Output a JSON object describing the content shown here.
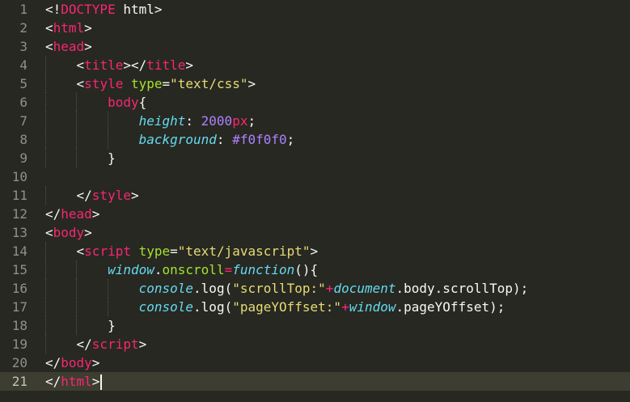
{
  "editor": {
    "active_line": 21,
    "lines": [
      {
        "no": "1",
        "indent": 0,
        "tokens": [
          {
            "c": "p",
            "t": "<!"
          },
          {
            "c": "t",
            "t": "DOCTYPE"
          },
          {
            "c": "p",
            "t": " html>"
          }
        ]
      },
      {
        "no": "2",
        "indent": 0,
        "tokens": [
          {
            "c": "p",
            "t": "<"
          },
          {
            "c": "t",
            "t": "html"
          },
          {
            "c": "p",
            "t": ">"
          }
        ]
      },
      {
        "no": "3",
        "indent": 0,
        "tokens": [
          {
            "c": "p",
            "t": "<"
          },
          {
            "c": "t",
            "t": "head"
          },
          {
            "c": "p",
            "t": ">"
          }
        ]
      },
      {
        "no": "4",
        "indent": 1,
        "tokens": [
          {
            "c": "p",
            "t": "<"
          },
          {
            "c": "t",
            "t": "title"
          },
          {
            "c": "p",
            "t": "></"
          },
          {
            "c": "t",
            "t": "title"
          },
          {
            "c": "p",
            "t": ">"
          }
        ]
      },
      {
        "no": "5",
        "indent": 1,
        "tokens": [
          {
            "c": "p",
            "t": "<"
          },
          {
            "c": "t",
            "t": "style"
          },
          {
            "c": "p",
            "t": " "
          },
          {
            "c": "a",
            "t": "type"
          },
          {
            "c": "p",
            "t": "="
          },
          {
            "c": "s",
            "t": "\"text/css\""
          },
          {
            "c": "p",
            "t": ">"
          }
        ]
      },
      {
        "no": "6",
        "indent": 2,
        "tokens": [
          {
            "c": "t",
            "t": "body"
          },
          {
            "c": "p",
            "t": "{"
          }
        ]
      },
      {
        "no": "7",
        "indent": 3,
        "tokens": [
          {
            "c": "c",
            "t": "height"
          },
          {
            "c": "p",
            "t": ": "
          },
          {
            "c": "n",
            "t": "2000"
          },
          {
            "c": "t",
            "t": "px"
          },
          {
            "c": "p",
            "t": ";"
          }
        ]
      },
      {
        "no": "8",
        "indent": 3,
        "tokens": [
          {
            "c": "c",
            "t": "background"
          },
          {
            "c": "p",
            "t": ": "
          },
          {
            "c": "n",
            "t": "#f0f0f0"
          },
          {
            "c": "p",
            "t": ";"
          }
        ]
      },
      {
        "no": "9",
        "indent": 2,
        "tokens": [
          {
            "c": "p",
            "t": "}"
          }
        ]
      },
      {
        "no": "10",
        "indent": 0,
        "tokens": []
      },
      {
        "no": "11",
        "indent": 1,
        "tokens": [
          {
            "c": "p",
            "t": "</"
          },
          {
            "c": "t",
            "t": "style"
          },
          {
            "c": "p",
            "t": ">"
          }
        ]
      },
      {
        "no": "12",
        "indent": 0,
        "tokens": [
          {
            "c": "p",
            "t": "</"
          },
          {
            "c": "t",
            "t": "head"
          },
          {
            "c": "p",
            "t": ">"
          }
        ]
      },
      {
        "no": "13",
        "indent": 0,
        "tokens": [
          {
            "c": "p",
            "t": "<"
          },
          {
            "c": "t",
            "t": "body"
          },
          {
            "c": "p",
            "t": ">"
          }
        ]
      },
      {
        "no": "14",
        "indent": 1,
        "tokens": [
          {
            "c": "p",
            "t": "<"
          },
          {
            "c": "t",
            "t": "script"
          },
          {
            "c": "p",
            "t": " "
          },
          {
            "c": "a",
            "t": "type"
          },
          {
            "c": "p",
            "t": "="
          },
          {
            "c": "s",
            "t": "\"text/javascript\""
          },
          {
            "c": "p",
            "t": ">"
          }
        ]
      },
      {
        "no": "15",
        "indent": 2,
        "tokens": [
          {
            "c": "c",
            "t": "window"
          },
          {
            "c": "p",
            "t": "."
          },
          {
            "c": "a",
            "t": "onscroll"
          },
          {
            "c": "t",
            "t": "="
          },
          {
            "c": "c",
            "t": "function"
          },
          {
            "c": "p",
            "t": "(){"
          }
        ]
      },
      {
        "no": "16",
        "indent": 3,
        "tokens": [
          {
            "c": "c",
            "t": "console"
          },
          {
            "c": "p",
            "t": "."
          },
          {
            "c": "p",
            "t": "log("
          },
          {
            "c": "s",
            "t": "\"scrollTop:\""
          },
          {
            "c": "t",
            "t": "+"
          },
          {
            "c": "c",
            "t": "document"
          },
          {
            "c": "p",
            "t": "."
          },
          {
            "c": "p",
            "t": "body"
          },
          {
            "c": "p",
            "t": ".scrollTop);"
          }
        ]
      },
      {
        "no": "17",
        "indent": 3,
        "tokens": [
          {
            "c": "c",
            "t": "console"
          },
          {
            "c": "p",
            "t": "."
          },
          {
            "c": "p",
            "t": "log("
          },
          {
            "c": "s",
            "t": "\"pageYOffset:\""
          },
          {
            "c": "t",
            "t": "+"
          },
          {
            "c": "c",
            "t": "window"
          },
          {
            "c": "p",
            "t": ".pageYOffset);"
          }
        ]
      },
      {
        "no": "18",
        "indent": 2,
        "tokens": [
          {
            "c": "p",
            "t": "}"
          }
        ]
      },
      {
        "no": "19",
        "indent": 1,
        "tokens": [
          {
            "c": "p",
            "t": "</"
          },
          {
            "c": "t",
            "t": "script"
          },
          {
            "c": "p",
            "t": ">"
          }
        ]
      },
      {
        "no": "20",
        "indent": 0,
        "tokens": [
          {
            "c": "p",
            "t": "</"
          },
          {
            "c": "t",
            "t": "body"
          },
          {
            "c": "p",
            "t": ">"
          }
        ]
      },
      {
        "no": "21",
        "indent": 0,
        "tokens": [
          {
            "c": "p",
            "t": "</"
          },
          {
            "c": "t",
            "t": "html"
          },
          {
            "c": "p",
            "t": ">"
          }
        ]
      }
    ]
  }
}
